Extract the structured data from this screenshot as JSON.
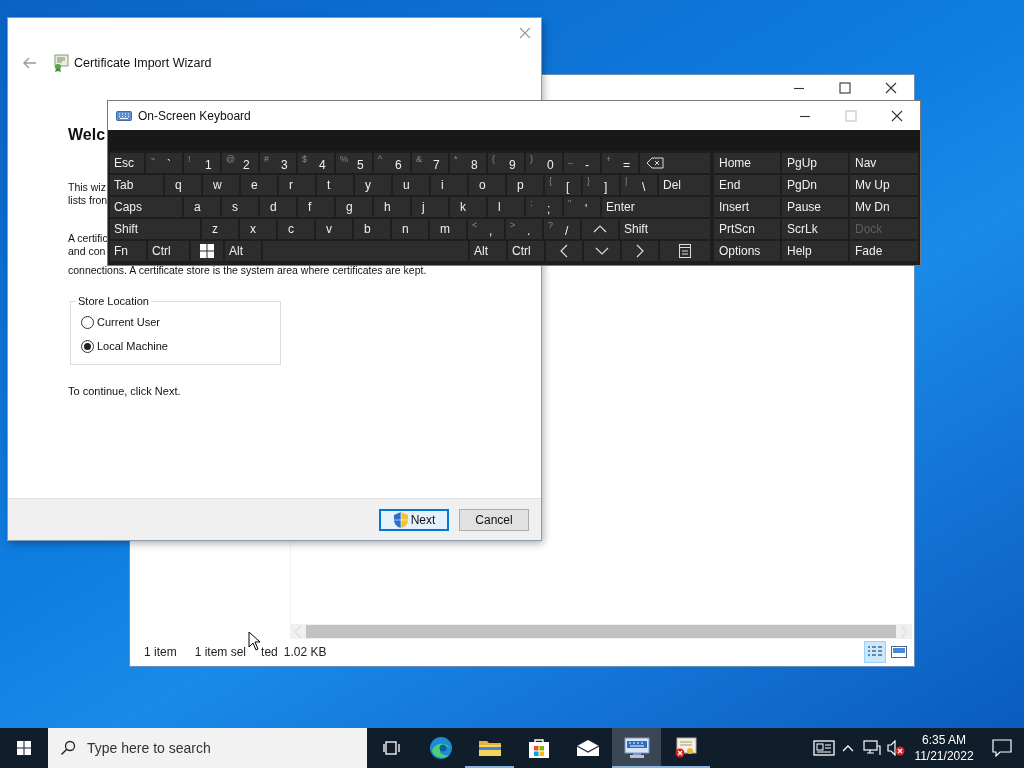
{
  "explorer_window": {
    "window_buttons": [
      {
        "kind": "minimize",
        "disabled": false
      },
      {
        "kind": "maximize",
        "disabled": false
      },
      {
        "kind": "close",
        "disabled": false
      }
    ],
    "status_bar": {
      "item_count": "1 item",
      "selection_start": "1 item sel",
      "selection_end": "ted",
      "size": "1.02 KB"
    },
    "view_buttons": [
      {
        "kind": "details",
        "selected": true
      },
      {
        "kind": "tiles",
        "selected": false
      }
    ]
  },
  "wizard": {
    "title": "Certificate Import Wizard",
    "heading": "Welc",
    "paragraphs": [
      [
        "This wiz",
        "lists fron"
      ],
      [
        "A certific",
        "and con",
        "connections. A certificate store is the system area where certificates are kept."
      ]
    ],
    "store_location": {
      "label": "Store Location",
      "options": [
        {
          "label": "Current User",
          "selected": false
        },
        {
          "label": "Local Machine",
          "selected": true
        }
      ]
    },
    "instruction": "To continue, click Next.",
    "buttons": [
      {
        "label": "Next",
        "kind": "shield",
        "default": true
      },
      {
        "label": "Cancel",
        "kind": "plain",
        "default": false
      }
    ]
  },
  "keyboard": {
    "title": "On-Screen Keyboard",
    "window_buttons": [
      {
        "kind": "minimize",
        "disabled": false
      },
      {
        "kind": "maximize",
        "disabled": true
      },
      {
        "kind": "close",
        "disabled": false
      }
    ],
    "rows": [
      [
        {
          "kind": "mod",
          "label": "Esc"
        },
        {
          "kind": "dual",
          "label": "`",
          "shift": "~"
        },
        {
          "kind": "dual",
          "label": "1",
          "shift": "!"
        },
        {
          "kind": "dual",
          "label": "2",
          "shift": "@"
        },
        {
          "kind": "dual",
          "label": "3",
          "shift": "#"
        },
        {
          "kind": "dual",
          "label": "4",
          "shift": "$"
        },
        {
          "kind": "dual",
          "label": "5",
          "shift": "%"
        },
        {
          "kind": "dual",
          "label": "6",
          "shift": "^"
        },
        {
          "kind": "dual",
          "label": "7",
          "shift": "&"
        },
        {
          "kind": "dual",
          "label": "8",
          "shift": "*"
        },
        {
          "kind": "dual",
          "label": "9",
          "shift": "("
        },
        {
          "kind": "dual",
          "label": "0",
          "shift": ")"
        },
        {
          "kind": "dual",
          "label": "-",
          "shift": "_"
        },
        {
          "kind": "dual",
          "label": "=",
          "shift": "+"
        },
        {
          "kind": "backspace"
        }
      ],
      [
        {
          "kind": "mod",
          "label": "Tab"
        },
        {
          "kind": "char",
          "label": "q"
        },
        {
          "kind": "char",
          "label": "w"
        },
        {
          "kind": "char",
          "label": "e"
        },
        {
          "kind": "char",
          "label": "r"
        },
        {
          "kind": "char",
          "label": "t"
        },
        {
          "kind": "char",
          "label": "y"
        },
        {
          "kind": "char",
          "label": "u"
        },
        {
          "kind": "char",
          "label": "i"
        },
        {
          "kind": "char",
          "label": "o"
        },
        {
          "kind": "char",
          "label": "p"
        },
        {
          "kind": "dual",
          "label": "[",
          "shift": "{"
        },
        {
          "kind": "dual",
          "label": "]",
          "shift": "}"
        },
        {
          "kind": "dual",
          "label": "\\",
          "shift": "|"
        },
        {
          "kind": "mod",
          "label": "Del"
        }
      ],
      [
        {
          "kind": "mod",
          "label": "Caps"
        },
        {
          "kind": "char",
          "label": "a"
        },
        {
          "kind": "char",
          "label": "s"
        },
        {
          "kind": "char",
          "label": "d"
        },
        {
          "kind": "char",
          "label": "f"
        },
        {
          "kind": "char",
          "label": "g"
        },
        {
          "kind": "char",
          "label": "h"
        },
        {
          "kind": "char",
          "label": "j"
        },
        {
          "kind": "char",
          "label": "k"
        },
        {
          "kind": "char",
          "label": "l"
        },
        {
          "kind": "dual",
          "label": ";",
          "shift": ":"
        },
        {
          "kind": "dual",
          "label": "'",
          "shift": "\""
        },
        {
          "kind": "mod",
          "label": "Enter"
        }
      ],
      [
        {
          "kind": "mod",
          "label": "Shift"
        },
        {
          "kind": "char",
          "label": "z"
        },
        {
          "kind": "char",
          "label": "x"
        },
        {
          "kind": "char",
          "label": "c"
        },
        {
          "kind": "char",
          "label": "v"
        },
        {
          "kind": "char",
          "label": "b"
        },
        {
          "kind": "char",
          "label": "n"
        },
        {
          "kind": "char",
          "label": "m"
        },
        {
          "kind": "dual",
          "label": ",",
          "shift": "<"
        },
        {
          "kind": "dual",
          "label": ".",
          "shift": ">"
        },
        {
          "kind": "dual",
          "label": "/",
          "shift": "?"
        },
        {
          "kind": "up"
        },
        {
          "kind": "mod",
          "label": "Shift"
        }
      ],
      [
        {
          "kind": "mod",
          "label": "Fn"
        },
        {
          "kind": "mod",
          "label": "Ctrl"
        },
        {
          "kind": "windows"
        },
        {
          "kind": "mod",
          "label": "Alt"
        },
        {
          "kind": "space"
        },
        {
          "kind": "mod",
          "label": "Alt"
        },
        {
          "kind": "mod",
          "label": "Ctrl"
        },
        {
          "kind": "left"
        },
        {
          "kind": "down"
        },
        {
          "kind": "right"
        },
        {
          "kind": "menu"
        }
      ]
    ],
    "nav_keys": [
      {
        "label": "Home",
        "disabled": false
      },
      {
        "label": "PgUp",
        "disabled": false
      },
      {
        "label": "Nav",
        "disabled": false
      },
      {
        "label": "End",
        "disabled": false
      },
      {
        "label": "PgDn",
        "disabled": false
      },
      {
        "label": "Mv Up",
        "disabled": false
      },
      {
        "label": "Insert",
        "disabled": false
      },
      {
        "label": "Pause",
        "disabled": false
      },
      {
        "label": "Mv Dn",
        "disabled": false
      },
      {
        "label": "PrtScn",
        "disabled": false
      },
      {
        "label": "ScrLk",
        "disabled": false
      },
      {
        "label": "Dock",
        "disabled": true
      },
      {
        "label": "Options",
        "disabled": false
      },
      {
        "label": "Help",
        "disabled": false
      },
      {
        "label": "Fade",
        "disabled": false
      }
    ]
  },
  "taskbar": {
    "search": {
      "placeholder": "Type here to search"
    },
    "apps": [
      {
        "kind": "task-view",
        "running": false,
        "selected": false
      },
      {
        "kind": "edge",
        "running": false,
        "selected": false
      },
      {
        "kind": "folder",
        "running": true,
        "selected": false
      },
      {
        "kind": "store",
        "running": false,
        "selected": false
      },
      {
        "kind": "mail",
        "running": false,
        "selected": false
      },
      {
        "kind": "keyboard",
        "running": true,
        "selected": true
      },
      {
        "kind": "certificate",
        "running": true,
        "selected": false
      }
    ],
    "tray": {
      "icons": [
        {
          "kind": "news"
        },
        {
          "kind": "chevron"
        },
        {
          "kind": "network"
        },
        {
          "kind": "volume-muted"
        }
      ],
      "time": "6:35 AM",
      "date": "11/21/2022"
    }
  }
}
